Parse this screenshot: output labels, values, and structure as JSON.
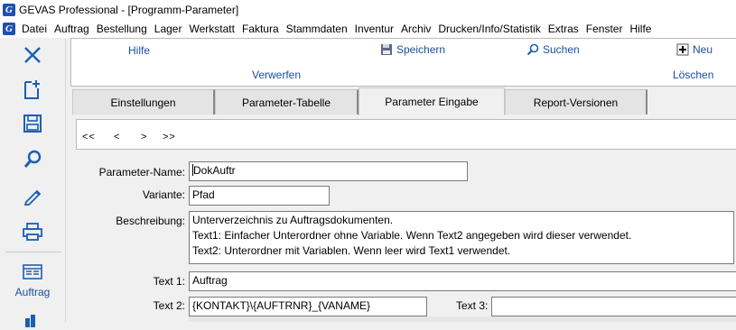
{
  "window": {
    "title": "GEVAS Professional - [Programm-Parameter]",
    "app_icon": "gevas-logo-icon"
  },
  "menu": [
    "Datei",
    "Auftrag",
    "Bestellung",
    "Lager",
    "Werkstatt",
    "Faktura",
    "Stammdaten",
    "Inventur",
    "Archiv",
    "Drucken/Info/Statistik",
    "Extras",
    "Fenster",
    "Hilfe"
  ],
  "sidebar": {
    "icons": [
      "close-icon",
      "new-document-icon",
      "save-icon",
      "search-icon",
      "edit-icon",
      "print-icon"
    ],
    "auftrag_label": "Auftrag"
  },
  "toolbar": {
    "hilfe": "Hilfe",
    "speichern": "Speichern",
    "suchen": "Suchen",
    "neu": "Neu",
    "verwerfen": "Verwerfen",
    "loeschen": "Löschen"
  },
  "tabs": [
    {
      "label": "Einstellungen"
    },
    {
      "label": "Parameter-Tabelle"
    },
    {
      "label": "Parameter Eingabe",
      "active": true
    },
    {
      "label": "Report-Versionen"
    }
  ],
  "nav": {
    "first": "<<",
    "prev": "<",
    "next": ">",
    "last": ">>"
  },
  "form": {
    "name_label": "Parameter-Name:",
    "name_value": "DokAuftr",
    "variant_label": "Variante:",
    "variant_value": "Pfad",
    "desc_label": "Beschreibung:",
    "desc_lines": [
      "Unterverzeichnis zu Auftragsdokumenten.",
      "Text1: Einfacher Unterordner ohne Variable. Wenn Text2 angegeben wird dieser verwendet.",
      "Text2: Unterordner mit Variablen. Wenn leer wird Text1 verwendet."
    ],
    "text1_label": "Text 1:",
    "text1_value": "Auftrag",
    "text2_label": "Text 2:",
    "text2_value": "{KONTAKT}\\{AUFTRNR}_{VANAME}",
    "text3_label": "Text 3:",
    "text3_value": ""
  }
}
